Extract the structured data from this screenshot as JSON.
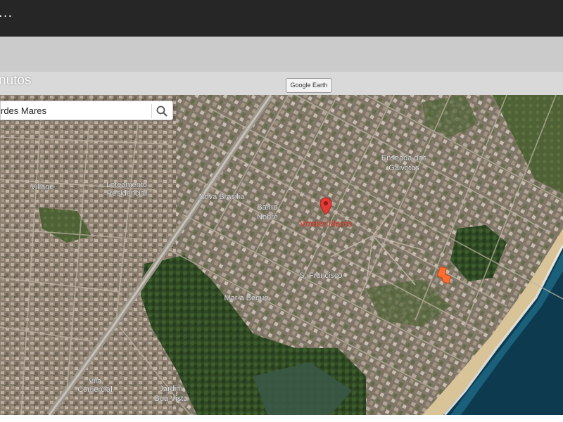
{
  "window": {
    "menu_dots": "...",
    "title": "nutos"
  },
  "toolbar": {
    "google_earth_label": "Google Earth"
  },
  "search": {
    "value": "rdes Mares",
    "icon": "search-icon"
  },
  "map": {
    "labels": {
      "enseada_line1": "Enseada das",
      "enseada_line2": "Gaivotas",
      "verdes_mares": "Verdes Mares",
      "bairro_line1": "Bairro",
      "bairro_line2": "Nobre",
      "sao_francisco": "S. Francisco",
      "jardim_line1": "Jardim",
      "jardim_line2": "Boa Vista",
      "mar_a_beque": "Mar a Beque",
      "village": "Village",
      "loteamento_line1": "Loteamento",
      "loteamento_line2": "Residencial",
      "vila_line1": "Vila",
      "vila_line2": "Comercial",
      "north_label": "Nova Brasilia"
    },
    "pin_color": "#e53935",
    "target_marker_color": "#ff6d2e"
  }
}
